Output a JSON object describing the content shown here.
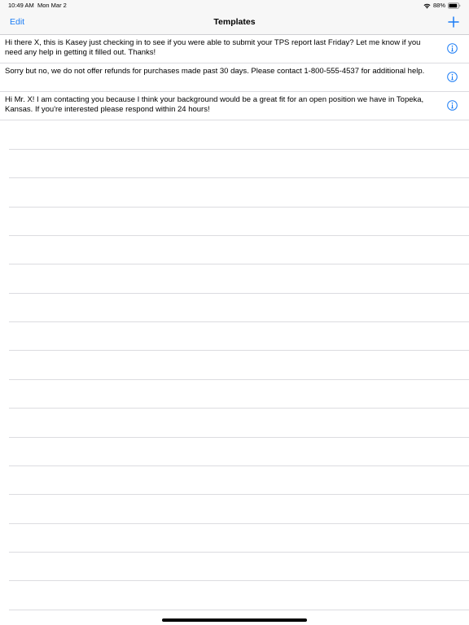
{
  "status_bar": {
    "time": "10:49 AM",
    "date": "Mon Mar 2",
    "battery": "88%",
    "wifi_icon": "wifi-icon",
    "battery_icon": "battery-icon"
  },
  "nav": {
    "edit_label": "Edit",
    "title": "Templates",
    "add_icon": "plus-icon"
  },
  "templates": [
    {
      "text": "Hi there X, this is Kasey just checking in to see if you were able to submit your TPS report last Friday? Let me know if you need any help in getting it filled out. Thanks!",
      "info_icon": "info-icon"
    },
    {
      "text": "Sorry but no, we do not offer refunds for purchases made past 30 days. Please contact 1-800-555-4537 for additional help.",
      "info_icon": "info-icon"
    },
    {
      "text": "Hi Mr. X! I am contacting you because I think your background would be a great fit for an open position we have in Topeka, Kansas. If you're interested please respond within 24 hours!",
      "info_icon": "info-icon"
    }
  ],
  "colors": {
    "accent": "#1a7cf5",
    "nav_background": "#f7f7f7",
    "separator": "#dcdce0"
  }
}
